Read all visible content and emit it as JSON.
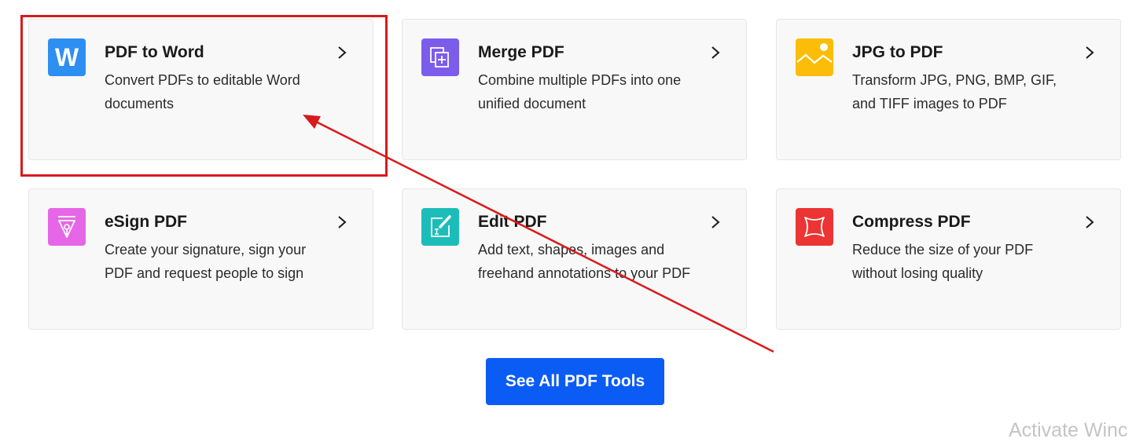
{
  "tools": [
    {
      "title": "PDF to Word",
      "desc": "Convert PDFs to editable Word documents",
      "icon": "word-icon",
      "color": "#2e8ff2"
    },
    {
      "title": "Merge PDF",
      "desc": "Combine multiple PDFs into one unified document",
      "icon": "merge-icon",
      "color": "#7c5ceb"
    },
    {
      "title": "JPG to PDF",
      "desc": "Transform JPG, PNG, BMP, GIF, and TIFF images to PDF",
      "icon": "image-icon",
      "color": "#fbbd08"
    },
    {
      "title": "eSign PDF",
      "desc": "Create your signature, sign your PDF and request people to sign",
      "icon": "pen-nib-icon",
      "color": "#e566e6"
    },
    {
      "title": "Edit PDF",
      "desc": "Add text, shapes, images and freehand annotations to your PDF",
      "icon": "edit-icon",
      "color": "#1cbdb9"
    },
    {
      "title": "Compress PDF",
      "desc": "Reduce the size of your PDF without losing quality",
      "icon": "compress-icon",
      "color": "#ed3434"
    }
  ],
  "cta": {
    "label": "See All PDF Tools",
    "color": "#0a5cf5"
  },
  "annotation": {
    "color": "#d91a1a"
  },
  "watermark": {
    "text": "Activate Winc"
  }
}
